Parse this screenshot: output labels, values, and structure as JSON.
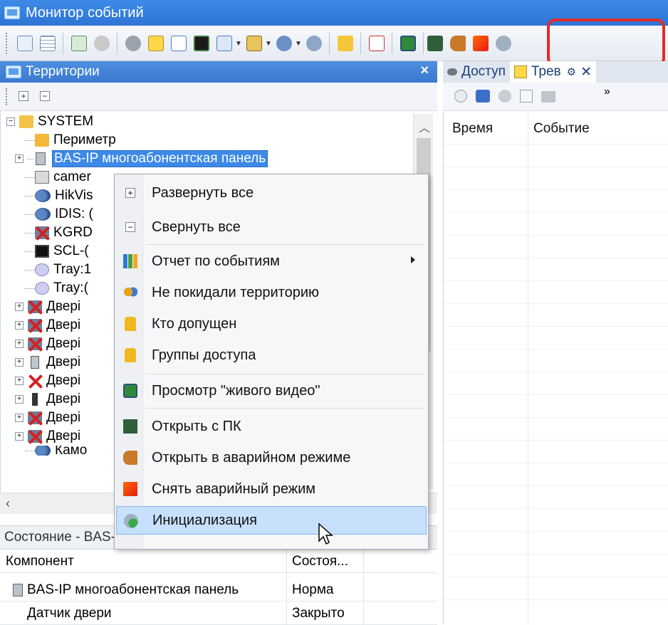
{
  "window": {
    "title": "Монитор событий"
  },
  "left_panel": {
    "title": "Территории",
    "tree": {
      "root": "SYSTEM",
      "items": [
        "Периметр",
        "BAS-IP многоабонентская панель",
        "camer",
        "HikVis",
        "IDIS: (",
        "KGRD",
        "SCL-(",
        "Tray:1",
        "Tray:(",
        "Двері",
        "Двері",
        "Двері",
        "Двері",
        "Двері",
        "Двері",
        "Двері",
        "Двері",
        "Камо"
      ]
    }
  },
  "right_panel": {
    "tabs": [
      "Доступ",
      "Трев"
    ],
    "columns": [
      "Время",
      "Событие"
    ]
  },
  "context_menu": {
    "items": [
      "Развернуть все",
      "Свернуть все",
      "Отчет по событиям",
      "Не покидали территорию",
      "Кто допущен",
      "Группы доступа",
      "Просмотр \"живого видео\"",
      "Открыть с ПК",
      "Открыть в аварийном режиме",
      "Снять аварийный режим",
      "Инициализация"
    ]
  },
  "status_panel": {
    "header": "Состояние - BAS-IP многоабонентская панель",
    "columns": [
      "Компонент",
      "Состоя..."
    ],
    "rows": [
      {
        "component": "BAS-IP многоабонентская панель",
        "state": "Норма"
      },
      {
        "component": "Датчик двери",
        "state": "Закрыто"
      }
    ]
  },
  "colors": {
    "title_bar": "#2e74d6",
    "highlight_box": "#e22a2a",
    "selection": "#3c89e8",
    "menu_hover": "#c7e0fb"
  }
}
